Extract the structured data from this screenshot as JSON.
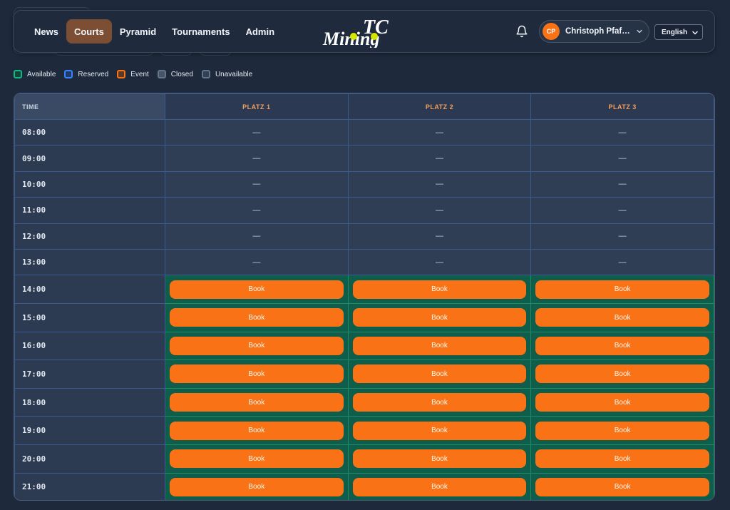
{
  "nav": {
    "items": [
      {
        "label": "News"
      },
      {
        "label": "Courts"
      },
      {
        "label": "Pyramid"
      },
      {
        "label": "Tournaments"
      },
      {
        "label": "Admin"
      }
    ]
  },
  "logo": {
    "text_top": "TC",
    "text_main": "Mining"
  },
  "user": {
    "initials": "CP",
    "name": "Christoph Pfaffi..."
  },
  "language": {
    "selected": "English"
  },
  "legend": [
    {
      "label": "Available",
      "color": "#10b981"
    },
    {
      "label": "Reserved",
      "color": "#3b82f6"
    },
    {
      "label": "Event",
      "color": "#f97316"
    },
    {
      "label": "Closed",
      "color": "#64748b"
    },
    {
      "label": "Unavailable",
      "color": "#64748b"
    }
  ],
  "schedule": {
    "time_header": "TIME",
    "courts": [
      "PLATZ 1",
      "PLATZ 2",
      "PLATZ 3"
    ],
    "book_label": "Book",
    "empty_mark": "—",
    "rows": [
      {
        "time": "08:00",
        "status": "closed"
      },
      {
        "time": "09:00",
        "status": "closed"
      },
      {
        "time": "10:00",
        "status": "closed"
      },
      {
        "time": "11:00",
        "status": "closed"
      },
      {
        "time": "12:00",
        "status": "closed"
      },
      {
        "time": "13:00",
        "status": "closed"
      },
      {
        "time": "14:00",
        "status": "available"
      },
      {
        "time": "15:00",
        "status": "available"
      },
      {
        "time": "16:00",
        "status": "available"
      },
      {
        "time": "17:00",
        "status": "available"
      },
      {
        "time": "18:00",
        "status": "available"
      },
      {
        "time": "19:00",
        "status": "available"
      },
      {
        "time": "20:00",
        "status": "available"
      },
      {
        "time": "21:00",
        "status": "available"
      }
    ]
  },
  "colors": {
    "accent": "#f97316",
    "available_bg": "#0f5e4b",
    "active_nav": "#7c4f35"
  }
}
